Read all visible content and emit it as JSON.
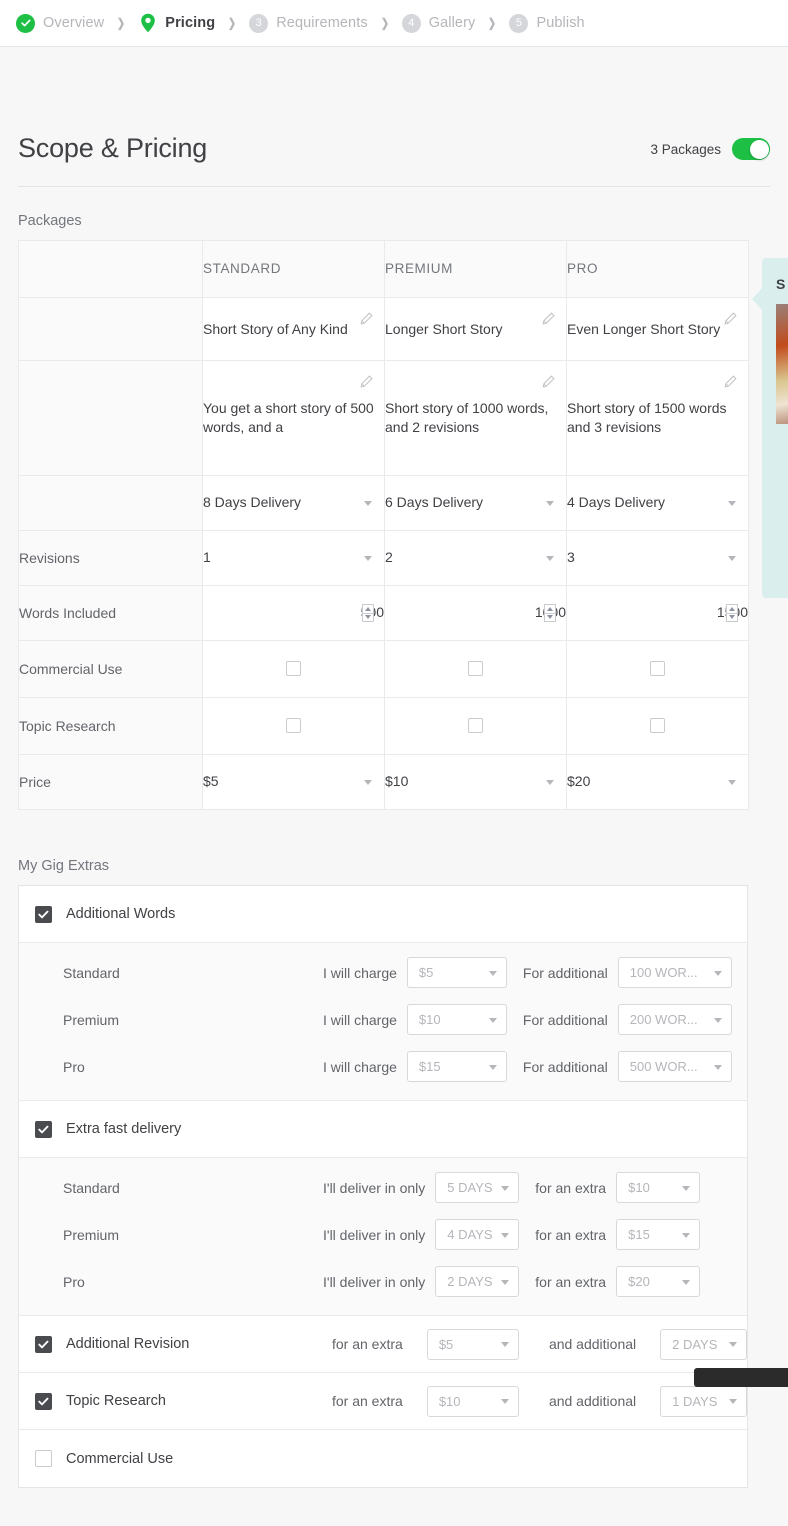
{
  "breadcrumb": {
    "steps": [
      {
        "label": "Overview",
        "marker": "check",
        "state": "done"
      },
      {
        "label": "Pricing",
        "marker": "pin",
        "state": "active"
      },
      {
        "label": "Requirements",
        "marker": "3",
        "state": "todo"
      },
      {
        "label": "Gallery",
        "marker": "4",
        "state": "todo"
      },
      {
        "label": "Publish",
        "marker": "5",
        "state": "todo"
      }
    ],
    "separator": "❯"
  },
  "header": {
    "title": "Scope & Pricing",
    "toggle_label": "3 Packages",
    "toggle_on": true,
    "accent_color": "#1dbf45"
  },
  "packages": {
    "section_label": "Packages",
    "columns": [
      "STANDARD",
      "PREMIUM",
      "PRO"
    ],
    "titles": [
      "Short Story of Any Kind",
      "Longer Short Story",
      "Even Longer Short Story"
    ],
    "descriptions": [
      "You get a short story of 500 words, and a",
      "Short story of 1000 words, and 2 revisions",
      "Short story of 1500 words and 3 revisions"
    ],
    "delivery": [
      "8 Days Delivery",
      "6 Days Delivery",
      "4 Days Delivery"
    ],
    "rows": [
      {
        "label": "Revisions",
        "type": "select",
        "values": [
          "1",
          "2",
          "3"
        ]
      },
      {
        "label": "Words Included",
        "type": "number",
        "values": [
          "500",
          "1000",
          "1500"
        ]
      },
      {
        "label": "Commercial Use",
        "type": "checkbox",
        "values": [
          false,
          false,
          false
        ]
      },
      {
        "label": "Topic Research",
        "type": "checkbox",
        "values": [
          false,
          false,
          false
        ]
      },
      {
        "label": "Price",
        "type": "select",
        "values": [
          "$5",
          "$10",
          "$20"
        ]
      }
    ]
  },
  "extras": {
    "section_label": "My Gig Extras",
    "groups": [
      {
        "name": "Additional Words",
        "checked": true,
        "rows": [
          {
            "tier": "Standard",
            "phrase1": "I will charge",
            "value1": "$5",
            "phrase2": "For additional",
            "value2": "100 WOR..."
          },
          {
            "tier": "Premium",
            "phrase1": "I will charge",
            "value1": "$10",
            "phrase2": "For additional",
            "value2": "200 WOR..."
          },
          {
            "tier": "Pro",
            "phrase1": "I will charge",
            "value1": "$15",
            "phrase2": "For additional",
            "value2": "500 WOR..."
          }
        ]
      },
      {
        "name": "Extra fast delivery",
        "checked": true,
        "rows": [
          {
            "tier": "Standard",
            "phrase1": "I'll deliver in only",
            "value1": "5 DAYS",
            "phrase2": "for an extra",
            "value2": "$10"
          },
          {
            "tier": "Premium",
            "phrase1": "I'll deliver in only",
            "value1": "4 DAYS",
            "phrase2": "for an extra",
            "value2": "$15"
          },
          {
            "tier": "Pro",
            "phrase1": "I'll deliver in only",
            "value1": "2 DAYS",
            "phrase2": "for an extra",
            "value2": "$20"
          }
        ]
      }
    ],
    "inline": [
      {
        "name": "Additional Revision",
        "checked": true,
        "phrase1": "for an extra",
        "value1": "$5",
        "phrase2": "and additional",
        "value2": "2 DAYS"
      },
      {
        "name": "Topic Research",
        "checked": true,
        "phrase1": "for an extra",
        "value1": "$10",
        "phrase2": "and additional",
        "value2": "1 DAYS"
      }
    ],
    "last": {
      "name": "Commercial Use",
      "checked": false
    }
  },
  "popover": {
    "title": "S"
  }
}
